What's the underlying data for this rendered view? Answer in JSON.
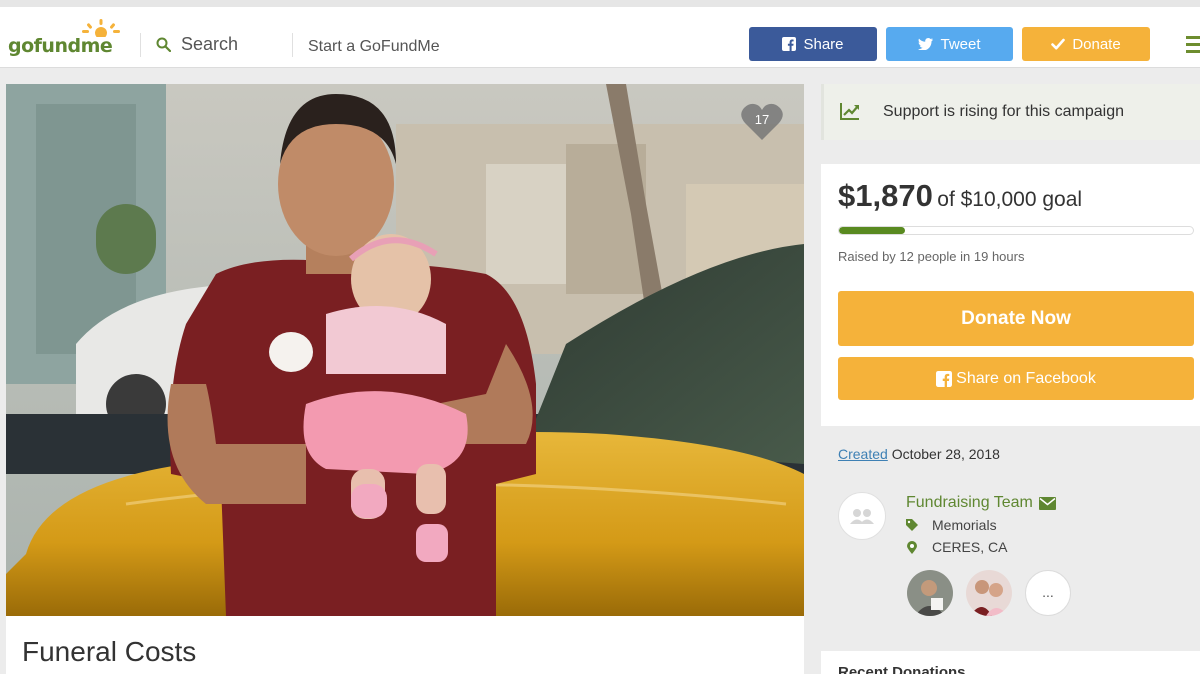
{
  "header": {
    "logo_text": "gofundme",
    "search_label": "Search",
    "start_label": "Start a GoFundMe",
    "share_label": "Share",
    "tweet_label": "Tweet",
    "donate_label": "Donate"
  },
  "campaign": {
    "heart_count": "17",
    "title": "Funeral Costs",
    "rising_text": "Support is rising for this campaign",
    "raised_amount": "$1,870",
    "goal_text": "of $10,000 goal",
    "progress_fraction": 0.187,
    "raised_by": "Raised by 12 people in 19 hours",
    "donate_now_label": "Donate Now",
    "share_facebook_label": "Share on Facebook",
    "created_label": "Created",
    "created_date": "October 28, 2018",
    "team_label": "Fundraising Team",
    "category": "Memorials",
    "location": "CERES, CA",
    "more_label": "...",
    "recent_heading": "Recent Donations"
  },
  "colors": {
    "brand_green": "#5f8731",
    "donate_orange": "#f5b23a",
    "facebook_blue": "#3b5a9a",
    "twitter_blue": "#57aaef"
  }
}
